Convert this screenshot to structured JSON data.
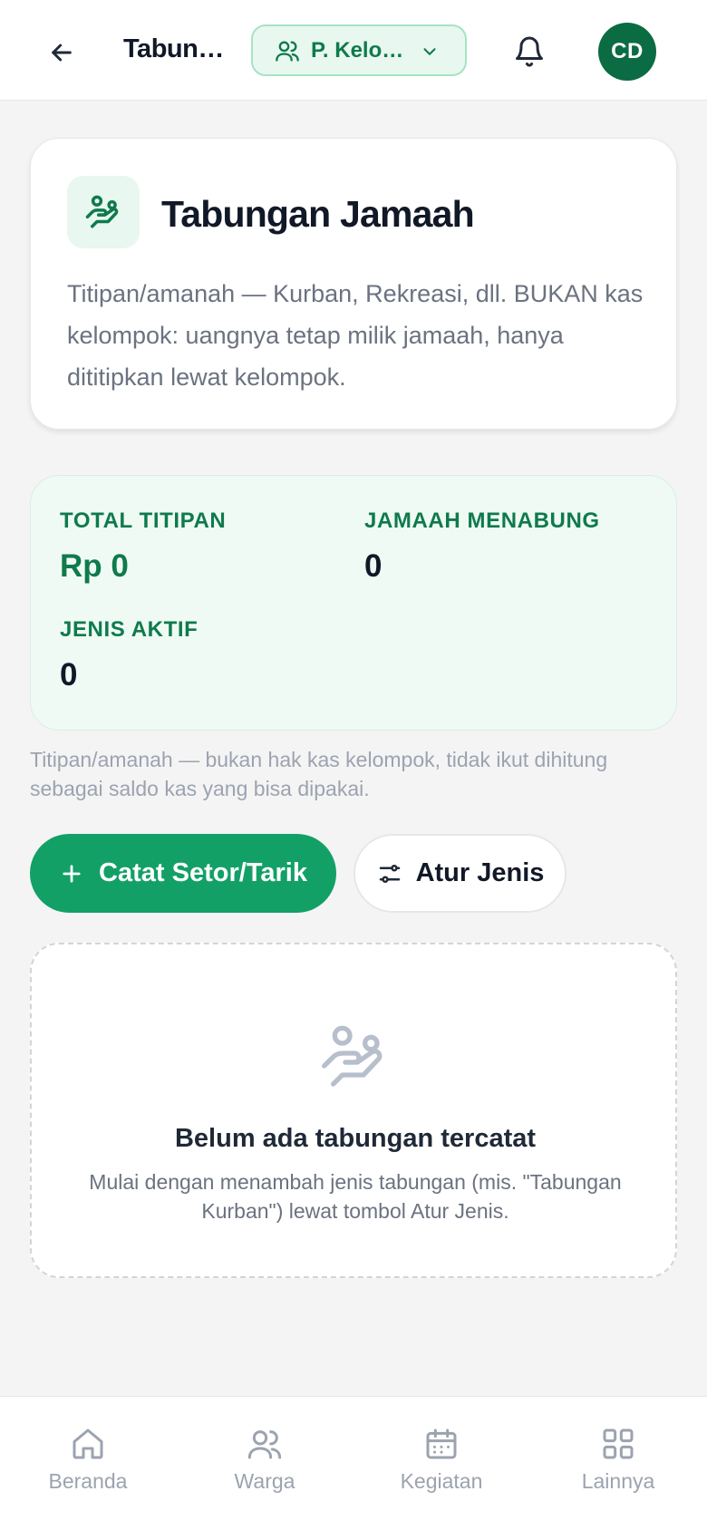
{
  "header": {
    "title": "Tabun…",
    "group_selector": "P. Kelo…",
    "avatar_initials": "CD"
  },
  "hero": {
    "title": "Tabungan Jamaah",
    "description": "Titipan/amanah — Kurban, Rekreasi, dll. BUKAN kas kelompok: uangnya tetap milik jamaah, hanya dititipkan lewat kelompok."
  },
  "stats": {
    "total_label": "TOTAL TITIPAN",
    "total_value": "Rp 0",
    "savers_label": "JAMAAH MENABUNG",
    "savers_value": "0",
    "types_label": "JENIS AKTIF",
    "types_value": "0"
  },
  "note": "Titipan/amanah — bukan hak kas kelompok, tidak ikut dihitung sebagai saldo kas yang bisa dipakai.",
  "actions": {
    "primary_label": "Catat Setor/Tarik",
    "secondary_label": "Atur Jenis"
  },
  "empty_state": {
    "title": "Belum ada tabungan tercatat",
    "description": "Mulai dengan menambah jenis tabungan (mis. \"Tabungan Kurban\") lewat tombol Atur Jenis."
  },
  "nav": {
    "items": [
      {
        "label": "Beranda",
        "icon": "home-icon"
      },
      {
        "label": "Warga",
        "icon": "users-icon"
      },
      {
        "label": "Kegiatan",
        "icon": "calendar-icon"
      },
      {
        "label": "Lainnya",
        "icon": "grid-icon"
      }
    ]
  },
  "colors": {
    "brand": "#12a067",
    "brand_dark": "#0b6b43",
    "accent_text": "#0f7a4c",
    "stats_bg": "#effaf4"
  }
}
